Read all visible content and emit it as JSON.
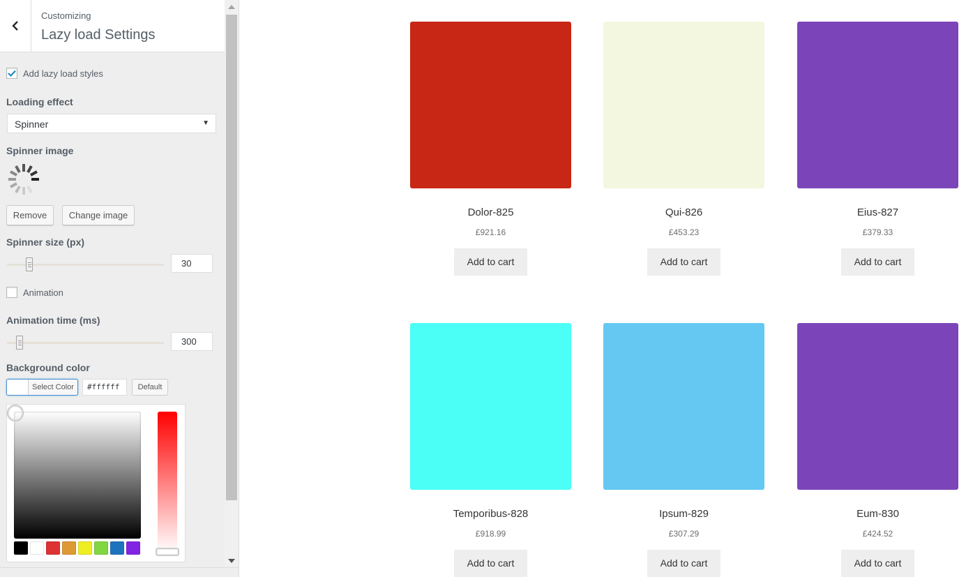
{
  "sidebar": {
    "header": {
      "subtitle": "Customizing",
      "title": "Lazy load Settings"
    },
    "add_lazy_load_styles": {
      "label": "Add lazy load styles",
      "checked": true
    },
    "loading_effect": {
      "label": "Loading effect",
      "selected": "Spinner"
    },
    "spinner_image": {
      "label": "Spinner image",
      "remove_label": "Remove",
      "change_label": "Change image"
    },
    "spinner_size": {
      "label": "Spinner size (px)",
      "value": "30"
    },
    "animation": {
      "label": "Animation",
      "checked": false
    },
    "animation_time": {
      "label": "Animation time (ms)",
      "value": "300"
    },
    "background_color": {
      "label": "Background color",
      "select_label": "Select Color",
      "hex_value": "#ffffff",
      "default_label": "Default",
      "palette": [
        "#000000",
        "#ffffff",
        "#dd3333",
        "#dd9933",
        "#eeee22",
        "#81d742",
        "#1e73be",
        "#8224e3"
      ]
    }
  },
  "products": [
    {
      "name": "Dolor-825",
      "price": "£921.16",
      "color": "#c92716",
      "button": "Add to cart"
    },
    {
      "name": "Qui-826",
      "price": "£453.23",
      "color": "#f3f7df",
      "button": "Add to cart"
    },
    {
      "name": "Eius-827",
      "price": "£379.33",
      "color": "#7b45b9",
      "button": "Add to cart"
    },
    {
      "name": "Temporibus-828",
      "price": "£918.99",
      "color": "#4bfff7",
      "button": "Add to cart"
    },
    {
      "name": "Ipsum-829",
      "price": "£307.29",
      "color": "#65c8f3",
      "button": "Add to cart"
    },
    {
      "name": "Eum-830",
      "price": "£424.52",
      "color": "#7b45b9",
      "button": "Add to cart"
    }
  ]
}
